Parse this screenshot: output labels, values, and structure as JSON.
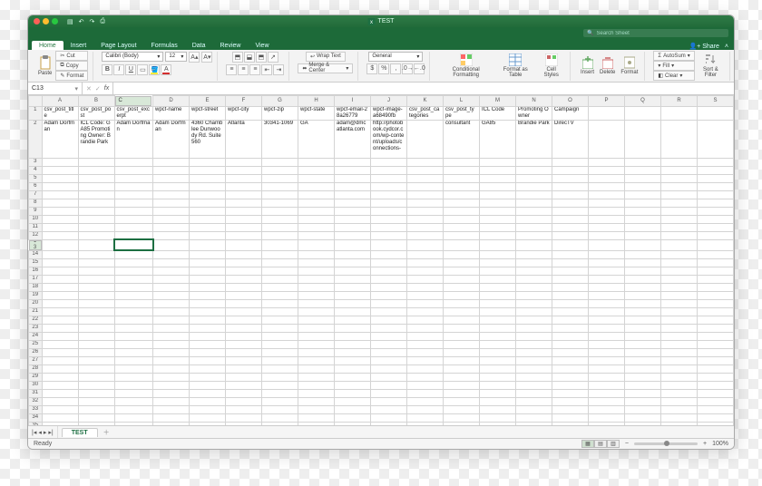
{
  "title": "TEST",
  "search_placeholder": "Search Sheet",
  "share_label": "Share",
  "tabs": [
    "Home",
    "Insert",
    "Page Layout",
    "Formulas",
    "Data",
    "Review",
    "View"
  ],
  "active_tab": "Home",
  "ribbon": {
    "paste": "Paste",
    "cut": "Cut",
    "copy": "Copy",
    "format_painter": "Format",
    "font_name": "Calibri (Body)",
    "font_size": "12",
    "wrap": "Wrap Text",
    "merge": "Merge & Center",
    "number_format": "General",
    "cond": "Conditional Formatting",
    "fmt_table": "Format as Table",
    "cell_styles": "Cell Styles",
    "insert": "Insert",
    "delete": "Delete",
    "format": "Format",
    "autosum": "AutoSum",
    "fill": "Fill",
    "clear": "Clear",
    "sortfilter": "Sort & Filter"
  },
  "name_box": "C13",
  "formula": "",
  "columns": [
    "A",
    "B",
    "C",
    "D",
    "E",
    "F",
    "G",
    "H",
    "I",
    "J",
    "K",
    "L",
    "M",
    "N",
    "O",
    "P",
    "Q",
    "R",
    "S"
  ],
  "rows_visible": 36,
  "data": {
    "1": {
      "A": "csv_post_title",
      "B": "csv_post_post",
      "C": "csv_post_excerpt",
      "D": "wpcf-name",
      "E": "wpcf-street",
      "F": "wpcf-city",
      "G": "wpcf-zip",
      "H": "wpcf-state",
      "I": "wpcf-email-28a26779",
      "J": "wpcf-image-a68490fb",
      "K": "csv_post_categories",
      "L": "csv_post_type",
      "M": "ICL Code",
      "N": "Promoting Owner",
      "O": "Campaign"
    },
    "2": {
      "A": "Adam Dorfman",
      "B": "ICL Code: GA85 Promoting Owner: Brandie Park",
      "C": "Adam Dorfman",
      "D": "Adam Dorfman",
      "E": "4360 Chamblee Dunwoody Rd. Suite 560",
      "F": "Atlanta",
      "G": "30341-1069",
      "H": "GA",
      "I": "adam@dmcatlanta.com",
      "J": "http://photobook.cydcor.com/wp-content/uploads/connections-",
      "K": "",
      "L": "consultant",
      "M": "GA85",
      "N": "Brandie Park",
      "O": "DirecTV"
    }
  },
  "selected": {
    "row": 13,
    "col": "C"
  },
  "sheet_tab": "TEST",
  "status_left": "Ready",
  "zoom": "100%"
}
